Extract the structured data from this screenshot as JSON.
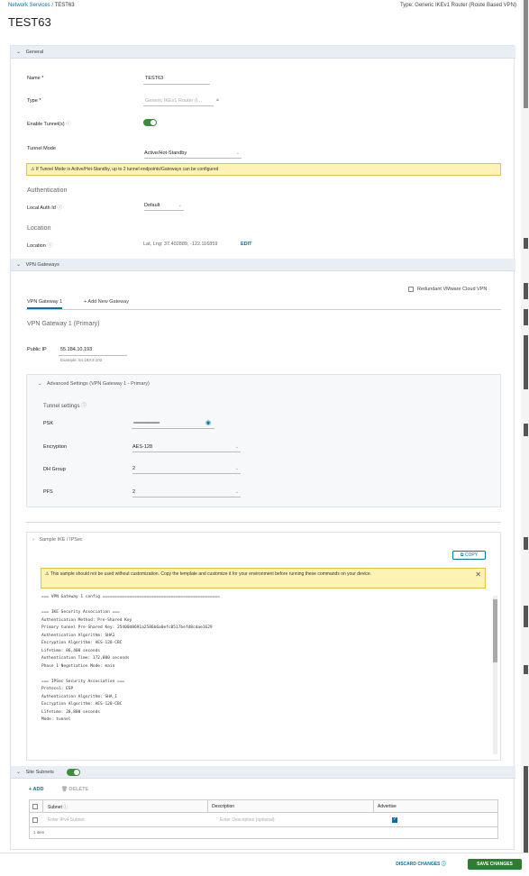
{
  "breadcrumb": {
    "root": "Network Services",
    "sep": "/",
    "current": "TEST63"
  },
  "type_info": "Type: Generic IKEv1 Router (Route Based VPN)",
  "page_title": "TEST63",
  "general": {
    "header": "General",
    "name_label": "Name *",
    "name_value": "TEST63",
    "type_label": "Type *",
    "type_value": "Generic IKEv1 Router (I...",
    "enable_label": "Enable Tunnel(s)",
    "tunnel_mode_label": "Tunnel Mode",
    "tunnel_mode_value": "Active/Hot-Standby",
    "warning": "If Tunnel Mode is Active/Hot-Standby, up to 2 tunnel endpoints/Gateways can be configured",
    "auth_heading": "Authentication",
    "local_auth_label": "Local Auth Id",
    "local_auth_value": "Default",
    "location_heading": "Location",
    "location_label": "Location",
    "location_value": "Lat, Lng: 37.402889, -122.116859",
    "edit_label": "EDIT"
  },
  "vpn": {
    "header": "VPN Gateways",
    "redundant_label": "Redundant VMware Cloud VPN",
    "tab_active": "VPN Gateway 1",
    "tab_add": "+ Add New Gateway",
    "gateway_heading": "VPN Gateway 1 (Primary)",
    "public_ip_label": "Public IP",
    "public_ip_value": "55.184.10.193",
    "public_ip_example": "Example: 54.183.3.102",
    "advanced_header": "Advanced Settings (VPN Gateway 1 - Primary)",
    "tunnel_settings": "Tunnel settings",
    "psk_label": "PSK",
    "psk_value": "••••••••••••••••••••••••••••••••",
    "encryption_label": "Encryption",
    "encryption_value": "AES-128",
    "dh_label": "DH Group",
    "dh_value": "2",
    "pfs_label": "PFS",
    "pfs_value": "2"
  },
  "sample": {
    "header": "Sample IKE / IPSec",
    "copy_label": "COPY",
    "warning": "This sample should not be used without customization. Copy the template and customize it for your environment before running these commands on your device.",
    "lines": [
      "=== VPN Gateway 1 config ================================================",
      "",
      "=== IKE Security Association ===",
      "Authentication Method: Pre-Shared Key",
      "Primary tunnel Pre-Shared Key: 25400d8691a2586b6a0efc0517befd8cdae1629",
      "Authentication Algorithm: SHA1",
      "Encryption Algorithm: AES-128-CBC",
      "Lifetime: 86,400 seconds",
      "Authentication Time: 172,800 seconds",
      "Phase 1 Negotiation Mode: main",
      "",
      "=== IPSec Security Association ===",
      "Protocol: ESP",
      "Authentication Algorithm: SHA_1",
      "Encryption Algorithm: AES-128-CBC",
      "Lifetime: 28,800 seconds",
      "Mode: tunnel"
    ]
  },
  "subnets": {
    "header": "Site Subnets",
    "add_label": "+ ADD",
    "delete_label": "DELETE",
    "col_subnet": "Subnet",
    "col_description": "Description",
    "col_advertise": "Advertise",
    "subnet_placeholder": "Enter IPv4 Subnet",
    "desc_placeholder": "Enter Description (optional)",
    "count": "1 item"
  },
  "footer": {
    "discard_label": "DISCARD CHANGES",
    "save_label": "SAVE CHANGES"
  },
  "colors": {
    "accent": "#0072a3",
    "toggle_on": "#3c8d3c",
    "save": "#2e7d32",
    "warning_bg": "#fef3b5"
  }
}
